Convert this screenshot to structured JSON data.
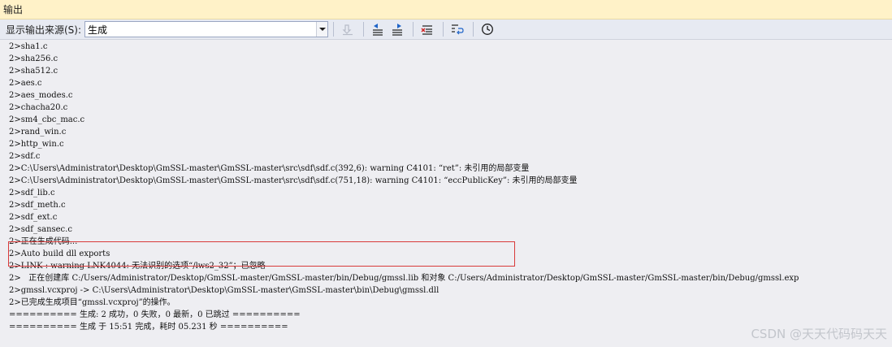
{
  "window": {
    "title": "输出"
  },
  "toolbar": {
    "source_label": "显示输出来源(S):",
    "source_value": "生成",
    "buttons": [
      {
        "name": "find-message-icon",
        "enabled": false
      },
      {
        "name": "previous-message-icon",
        "enabled": true
      },
      {
        "name": "next-message-icon",
        "enabled": true
      },
      {
        "name": "clear-all-icon",
        "enabled": true
      },
      {
        "name": "toggle-word-wrap-icon",
        "enabled": true
      },
      {
        "name": "timestamp-clock-icon",
        "enabled": true
      }
    ]
  },
  "output": {
    "lines": [
      "2>sha1.c",
      "2>sha256.c",
      "2>sha512.c",
      "2>aes.c",
      "2>aes_modes.c",
      "2>chacha20.c",
      "2>sm4_cbc_mac.c",
      "2>rand_win.c",
      "2>http_win.c",
      "2>sdf.c",
      "2>C:\\Users\\Administrator\\Desktop\\GmSSL-master\\GmSSL-master\\src\\sdf\\sdf.c(392,6): warning C4101: “ret”: 未引用的局部变量",
      "2>C:\\Users\\Administrator\\Desktop\\GmSSL-master\\GmSSL-master\\src\\sdf\\sdf.c(751,18): warning C4101: “eccPublicKey”: 未引用的局部变量",
      "2>sdf_lib.c",
      "2>sdf_meth.c",
      "2>sdf_ext.c",
      "2>sdf_sansec.c",
      "2>正在生成代码...",
      "2>Auto build dll exports",
      "2>LINK : warning LNK4044: 无法识别的选项“/lws2_32”；已忽略",
      "2>   正在创建库 C:/Users/Administrator/Desktop/GmSSL-master/GmSSL-master/bin/Debug/gmssl.lib 和对象 C:/Users/Administrator/Desktop/GmSSL-master/GmSSL-master/bin/Debug/gmssl.exp",
      "2>gmssl.vcxproj -> C:\\Users\\Administrator\\Desktop\\GmSSL-master\\GmSSL-master\\bin\\Debug\\gmssl.dll",
      "2>已完成生成项目“gmssl.vcxproj”的操作。",
      "========== 生成: 2 成功，0 失败，0 最新，0 已跳过 ==========",
      "========== 生成 于 15:51 完成，耗时 05.231 秒 =========="
    ]
  },
  "watermark": "CSDN @天天代码码天天"
}
